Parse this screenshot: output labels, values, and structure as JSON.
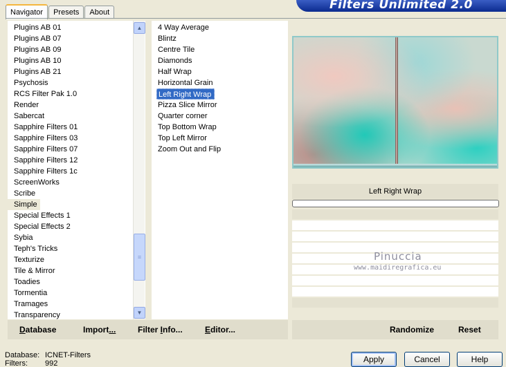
{
  "tabs": [
    {
      "label": "Navigator",
      "active": true
    },
    {
      "label": "Presets",
      "active": false
    },
    {
      "label": "About",
      "active": false
    }
  ],
  "banner_title": "Filters Unlimited 2.0",
  "categories": [
    "Plugins AB 01",
    "Plugins AB 07",
    "Plugins AB 09",
    "Plugins AB 10",
    "Plugins AB 21",
    "Psychosis",
    "RCS Filter Pak 1.0",
    "Render",
    "Sabercat",
    "Sapphire Filters 01",
    "Sapphire Filters 03",
    "Sapphire Filters 07",
    "Sapphire Filters 12",
    "Sapphire Filters 1c",
    "ScreenWorks",
    "Scribe",
    "Simple",
    "Special Effects 1",
    "Special Effects 2",
    "Sybia",
    "Teph's Tricks",
    "Texturize",
    "Tile & Mirror",
    "Toadies",
    "Tormentia",
    "Tramages",
    "Transparency"
  ],
  "highlighted_category": "Simple",
  "filters": [
    "4 Way Average",
    "Blintz",
    "Centre Tile",
    "Diamonds",
    "Half Wrap",
    "Horizontal Grain",
    "Left Right Wrap",
    "Pizza Slice Mirror",
    "Quarter corner",
    "Top Bottom Wrap",
    "Top Left Mirror",
    "Zoom Out and Flip"
  ],
  "selected_filter": "Left Right Wrap",
  "filter_name_display": "Left Right Wrap",
  "watermark": {
    "name": "Pinuccia",
    "url": "www.maidiregrafica.eu"
  },
  "left_buttons": {
    "database": {
      "u": "D",
      "rest": "atabase"
    },
    "import": {
      "pre": "Import",
      "u": "...",
      "post": ""
    },
    "filter_info": {
      "pre": "Filter ",
      "u": "I",
      "post": "nfo..."
    },
    "editor": {
      "u": "E",
      "rest": "ditor..."
    }
  },
  "right_buttons": {
    "randomize": "Randomize",
    "reset": "Reset"
  },
  "status": {
    "database_label": "Database:",
    "database_value": "ICNET-Filters",
    "filters_label": "Filters:",
    "filters_value": "992"
  },
  "dialog_buttons": {
    "apply": "Apply",
    "cancel": "Cancel",
    "help": "Help"
  },
  "icons": {
    "scroll_up": "triangle-up",
    "scroll_down": "triangle-down",
    "thumb_grip": "grip-lines"
  },
  "colors": {
    "selection": "#316ac5",
    "banner": "#0b2a8f",
    "tab_accent": "#f5b63e"
  }
}
